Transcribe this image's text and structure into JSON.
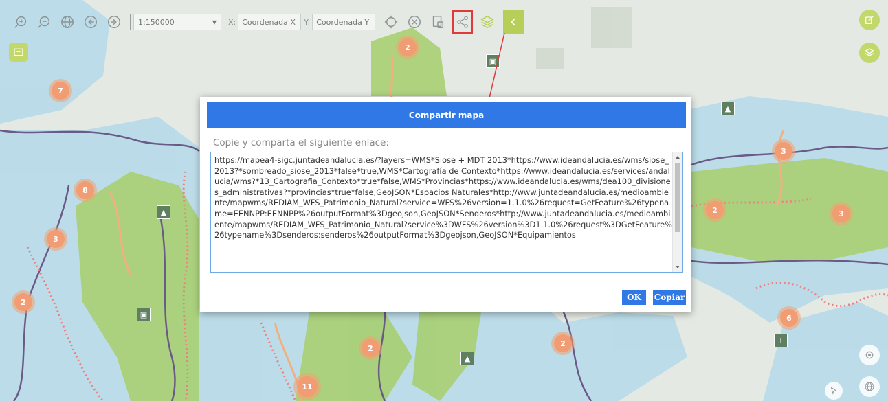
{
  "toolbar": {
    "scale_value": "1:150000",
    "coord_x_label": "X:",
    "coord_x_placeholder": "Coordenada X",
    "coord_y_label": "Y:",
    "coord_y_placeholder": "Coordenada Y"
  },
  "clusters": [
    "2",
    "7",
    "8",
    "3",
    "2",
    "3",
    "2",
    "3",
    "6",
    "2",
    "2",
    "11"
  ],
  "modal": {
    "title": "Compartir mapa",
    "instruction": "Copie y comparta el siguiente enlace:",
    "link": "https://mapea4-sigc.juntadeandalucia.es/?layers=WMS*Siose + MDT 2013*https://www.ideandalucia.es/wms/siose_2013?*sombreado_siose_2013*false*true,WMS*Cartografía de Contexto*https://www.ideandalucia.es/services/andalucia/wms?*13_Cartografia_Contexto*true*false,WMS*Provincias*https://www.ideandalucia.es/wms/dea100_divisiones_administrativas?*provincias*true*false,GeoJSON*Espacios Naturales*http://www.juntadeandalucia.es/medioambiente/mapwms/REDIAM_WFS_Patrimonio_Natural?service=WFS%26version=1.1.0%26request=GetFeature%26typename=EENNPP:EENNPP%26outputFormat%3Dgeojson,GeoJSON*Senderos*http://www.juntadeandalucia.es/medioambiente/mapwms/REDIAM_WFS_Patrimonio_Natural?service%3DWFS%26version%3D1.1.0%26request%3DGetFeature%26typename%3Dsenderos:senderos%26outputFormat%3Dgeojson,GeoJSON*Equipamientos",
    "ok_label": "OK",
    "copy_label": "Copiar"
  },
  "colors": {
    "accent_blue": "#2f78e6",
    "toolbar_green": "#b7cf59",
    "highlight_red": "#e03a3a",
    "cluster_orange": "#f19c72"
  }
}
